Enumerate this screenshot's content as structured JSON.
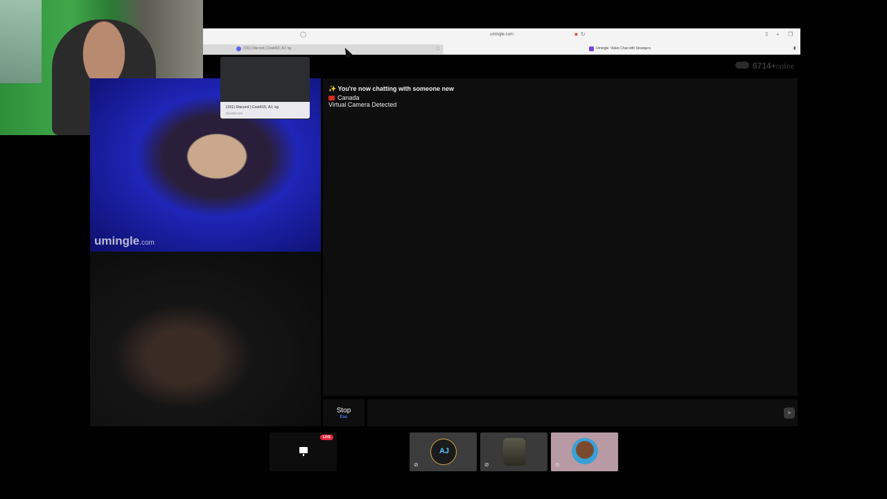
{
  "browser": {
    "url": "umingle.com",
    "tabs": [
      {
        "title": "(151) Discord | Cost415, AJ, kg"
      },
      {
        "title": "Umingle: Video Chat with Strangers"
      }
    ]
  },
  "discord_popup": {
    "title": "(151) Discord | Cost415, AJ, kg",
    "url": "discord.com"
  },
  "video": {
    "watermark_main": "umingle",
    "watermark_suffix": ".com"
  },
  "online": {
    "count": "6714+",
    "label": "online"
  },
  "chat": {
    "messages": [
      {
        "icon": "sparkle-icon",
        "text": "✨ You're now chatting with someone new"
      },
      {
        "icon": "canada-flag-icon",
        "text": "Canada"
      },
      {
        "text": "Virtual Camera Detected"
      }
    ],
    "input_placeholder": "",
    "stop_label": "Stop",
    "stop_key": "Esc"
  },
  "participants": {
    "live_badge": "LIVE",
    "tiles": [
      {
        "name": "screen-share",
        "icon": "monitor-icon"
      },
      {
        "avatar_text": "AJ",
        "muted": true
      },
      {
        "muted": true
      },
      {
        "muted": true
      }
    ]
  },
  "colors": {
    "accent_blue": "#4d7cff",
    "live_red": "#e8293a",
    "panel_bg": "#0e0e0e"
  }
}
